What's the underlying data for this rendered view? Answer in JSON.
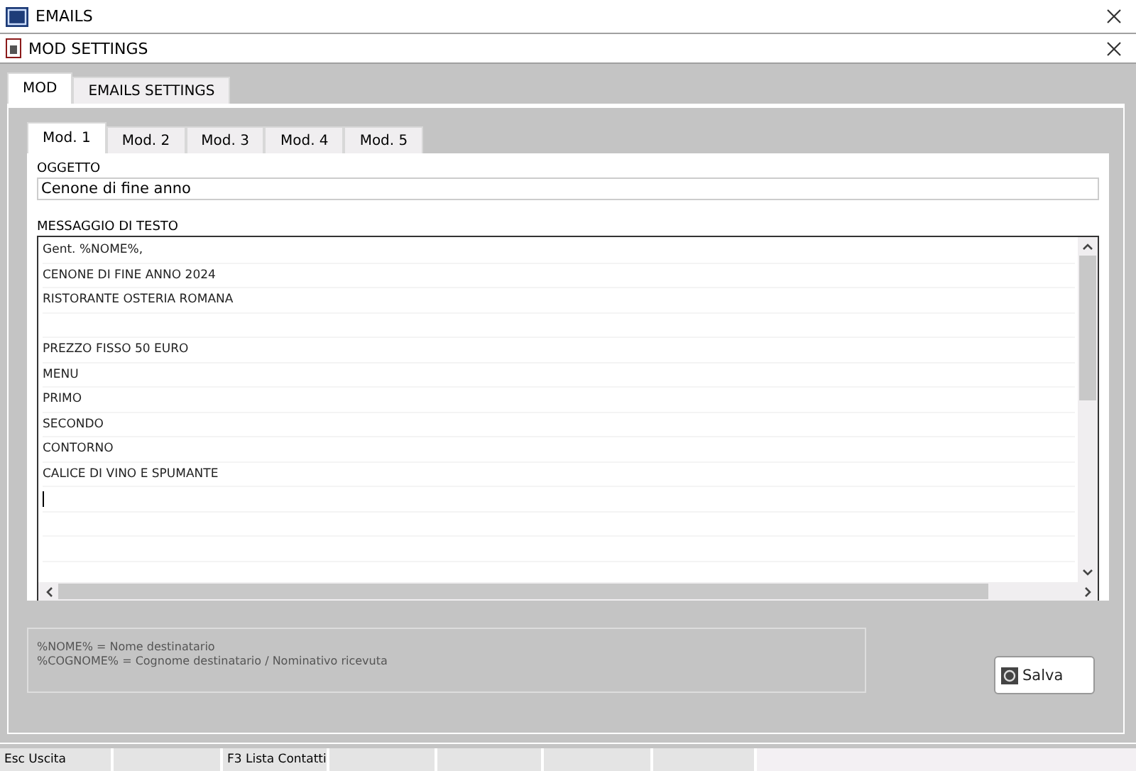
{
  "window": {
    "title": "EMAILS"
  },
  "dialog": {
    "title": "MOD SETTINGS"
  },
  "tabs": [
    {
      "label": "MOD",
      "selected": true
    },
    {
      "label": "EMAILS SETTINGS",
      "selected": false
    }
  ],
  "mod_tabs": [
    {
      "label": "Mod. 1",
      "selected": true
    },
    {
      "label": "Mod. 2",
      "selected": false
    },
    {
      "label": "Mod. 3",
      "selected": false
    },
    {
      "label": "Mod. 4",
      "selected": false
    },
    {
      "label": "Mod. 5",
      "selected": false
    }
  ],
  "subject": {
    "label": "OGGETTO",
    "value": "Cenone di fine anno"
  },
  "message": {
    "label": "MESSAGGIO DI TESTO",
    "lines": [
      {
        "kind": "text",
        "text": "Gent. %NOME%,"
      },
      {
        "kind": "text",
        "text": "CENONE DI FINE ANNO 2024"
      },
      {
        "kind": "text",
        "text": "RISTORANTE OSTERIA ROMANA"
      },
      {
        "kind": "blank"
      },
      {
        "kind": "text",
        "text": "PREZZO FISSO 50 EURO"
      },
      {
        "kind": "text",
        "text": "MENU"
      },
      {
        "kind": "text",
        "text": "PRIMO"
      },
      {
        "kind": "text",
        "text": "SECONDO"
      },
      {
        "kind": "text",
        "text": "CONTORNO"
      },
      {
        "kind": "text",
        "text": "CALICE DI VINO E SPUMANTE"
      },
      {
        "kind": "cursor"
      }
    ]
  },
  "legend": [
    "%NOME% = Nome destinatario",
    "%COGNOME% = Cognome destinatario / Nominativo ricevuta"
  ],
  "buttons": [
    {
      "label": "Salva"
    }
  ],
  "status_bar": [
    {
      "kind": "text",
      "text": "Esc Uscita"
    },
    {
      "kind": "empty"
    },
    {
      "kind": "text",
      "text": "F3 Lista Contatti"
    },
    {
      "kind": "empty"
    },
    {
      "kind": "empty"
    },
    {
      "kind": "empty"
    },
    {
      "kind": "empty"
    }
  ]
}
